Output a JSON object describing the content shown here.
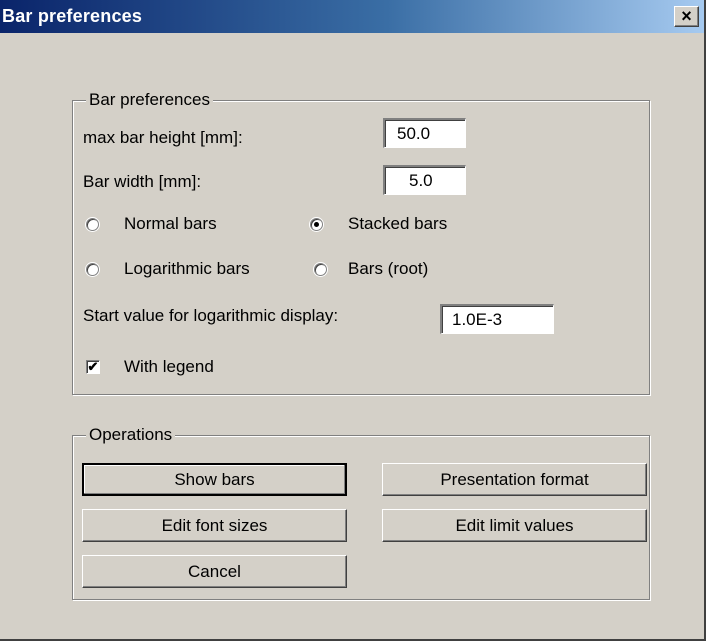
{
  "window": {
    "title": "Bar preferences",
    "close_glyph": "×"
  },
  "bar_group": {
    "legend": "Bar preferences",
    "max_height_label": "max bar height [mm]:",
    "max_height_value": "50.0",
    "width_label": "Bar width [mm]:",
    "width_value": "5.0",
    "radios": {
      "normal": {
        "label": "Normal bars",
        "checked": false
      },
      "stacked": {
        "label": "Stacked bars",
        "checked": true
      },
      "log": {
        "label": "Logarithmic bars",
        "checked": false
      },
      "root": {
        "label": "Bars (root)",
        "checked": false
      }
    },
    "start_value_label": "Start value for logarithmic display:",
    "start_value": "1.0E-3",
    "legend_checkbox": {
      "label": "With legend",
      "checked": true,
      "glyph": "✔"
    }
  },
  "operations": {
    "legend": "Operations",
    "show_bars": "Show bars",
    "presentation_format": "Presentation format",
    "edit_font_sizes": "Edit font sizes",
    "edit_limit_values": "Edit limit values",
    "cancel": "Cancel"
  }
}
